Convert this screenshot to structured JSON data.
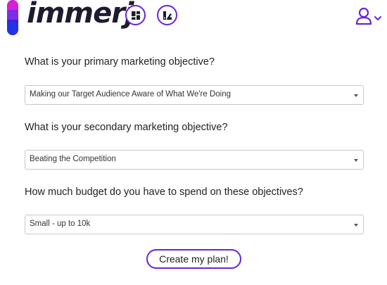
{
  "brand": {
    "name": "immerj",
    "accent_color": "#6a24d6"
  },
  "header": {
    "dashboard_icon": "dashboard-icon",
    "palette_icon": "palette-icon",
    "user_icon": "user-icon",
    "user_menu_caret_icon": "chevron-down-icon"
  },
  "form": {
    "primary_objective": {
      "question": "What is your primary marketing objective?",
      "selected": "Making our Target Audience Aware of What We're Doing"
    },
    "secondary_objective": {
      "question": "What is your secondary marketing objective?",
      "selected": "Beating the Competition"
    },
    "budget": {
      "question": "How much budget do you have to spend on these objectives?",
      "selected": "Small - up to 10k"
    },
    "submit_label": "Create my plan!"
  }
}
